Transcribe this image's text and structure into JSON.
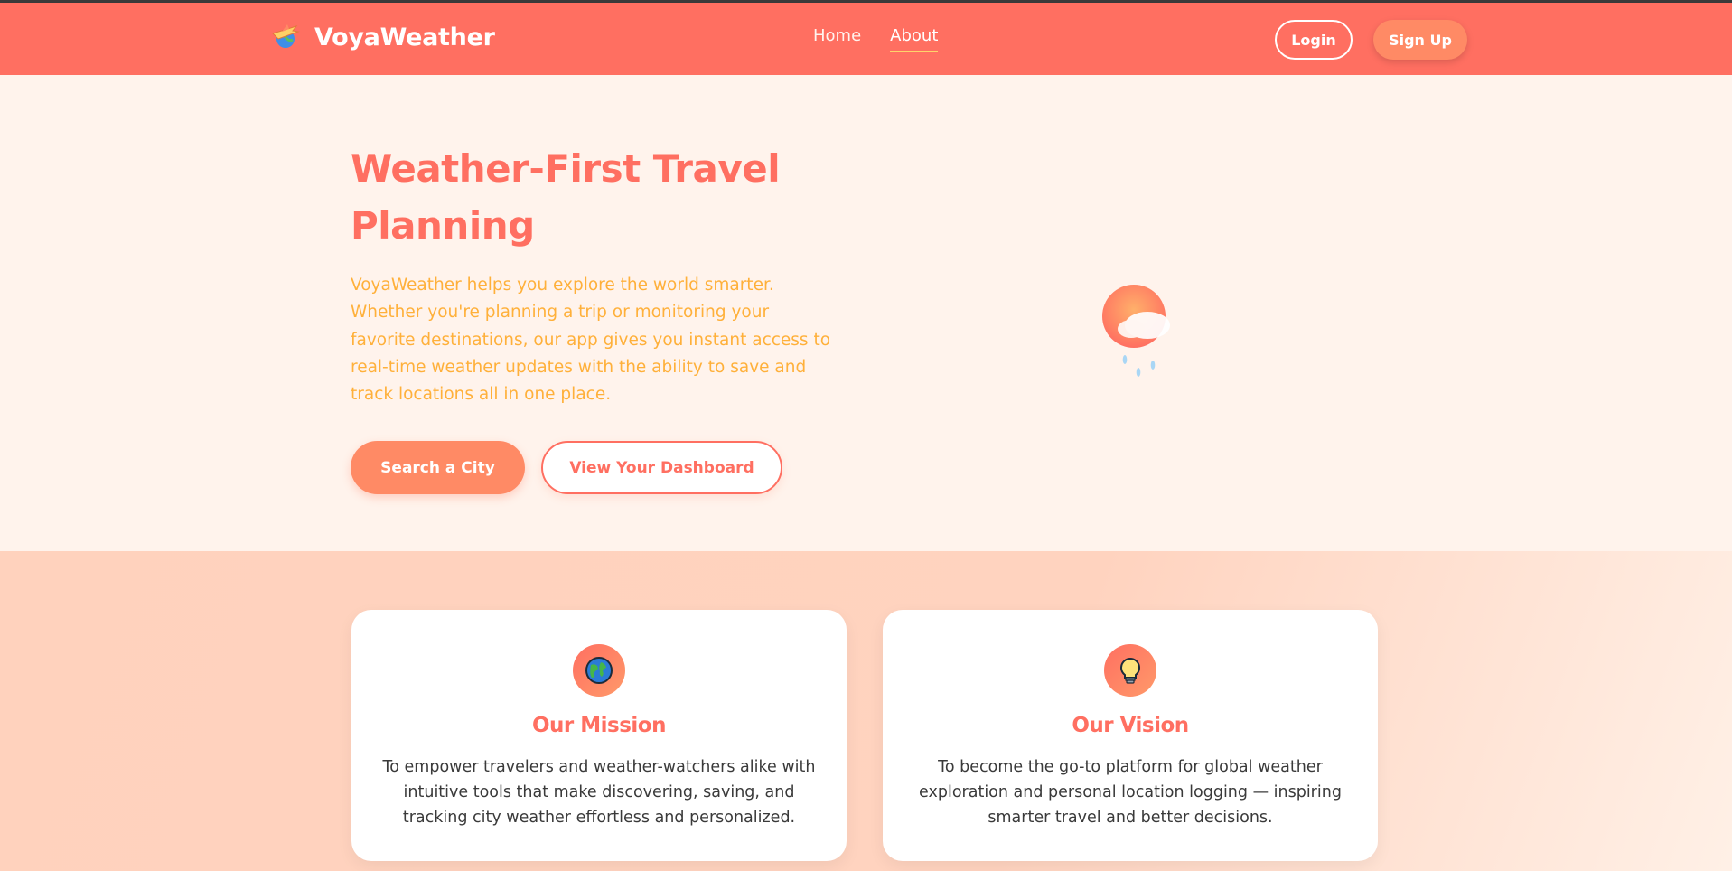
{
  "navbar": {
    "brand": "VoyaWeather",
    "brand_icon": "airplane-globe-icon",
    "links": [
      {
        "label": "Home",
        "active": false
      },
      {
        "label": "About",
        "active": true
      }
    ],
    "login_label": "Login",
    "signup_label": "Sign Up"
  },
  "hero": {
    "title": "Weather-First Travel Planning",
    "description": "VoyaWeather helps you explore the world smarter. Whether you're planning a trip or monitoring your favorite destinations, our app gives you instant access to real-time weather updates with the ability to save and track locations all in one place.",
    "primary_button": "Search a City",
    "secondary_button": "View Your Dashboard",
    "illustration": "sun-cloud-rain-icon"
  },
  "features": [
    {
      "icon": "globe-icon",
      "title": "Our Mission",
      "text": "To empower travelers and weather-watchers alike with intuitive tools that make discovering, saving, and tracking city weather effortless and personalized."
    },
    {
      "icon": "lightbulb-icon",
      "title": "Our Vision",
      "text": "To become the go-to platform for global weather exploration and personal location logging — inspiring smarter travel and better decisions."
    }
  ],
  "colors": {
    "primary": "#ff6f61",
    "accent": "#ff8a65",
    "text_highlight": "#ffb03a",
    "hero_bg": "#fff3ec"
  }
}
